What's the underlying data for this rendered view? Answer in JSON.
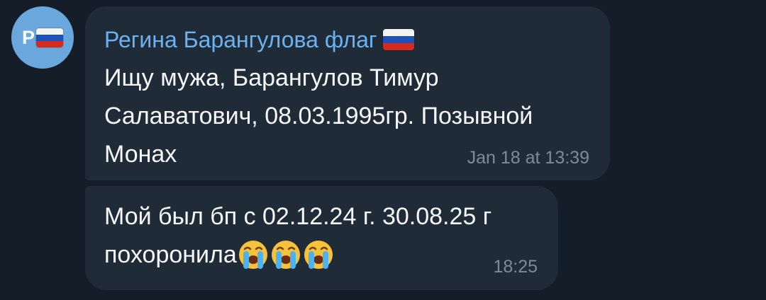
{
  "avatar": {
    "initial": "Р",
    "color": "#6aa7dc"
  },
  "messages": [
    {
      "sender": "Регина Барангулова флаг",
      "sender_color": "#6ab2f2",
      "lines": [
        "Ищу мужа, Барангулов Тимур",
        "Салаватович, 08.03.1995гр. Позывной",
        "Монах"
      ],
      "time": "Jan 18 at 13:39"
    },
    {
      "lines": [
        "Мой был бп с 02.12.24 г. 30.08.25 г",
        "похоронила"
      ],
      "emoji": [
        "loudly-crying-face",
        "loudly-crying-face",
        "loudly-crying-face"
      ],
      "time": "18:25"
    }
  ]
}
